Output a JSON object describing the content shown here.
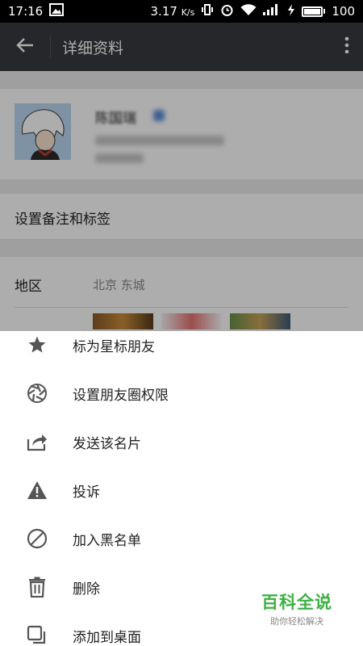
{
  "status_bar": {
    "time": "17:16",
    "speed": "3.17",
    "speed_unit": "K/s",
    "battery": "100",
    "battery_level": 1.0
  },
  "app_bar": {
    "title": "详细资料",
    "back_icon": "back-arrow-icon",
    "more_icon": "more-vertical-icon"
  },
  "profile": {
    "name": "陈国瑞",
    "wechat_id_label": "微信号",
    "nickname_label": "昵称"
  },
  "rows": {
    "remark": "设置备注和标签",
    "region_label": "地区",
    "region_value": "北京  东城"
  },
  "menu": {
    "items": [
      {
        "label": "标为星标朋友",
        "icon": "star-icon"
      },
      {
        "label": "设置朋友圈权限",
        "icon": "aperture-icon"
      },
      {
        "label": "发送该名片",
        "icon": "share-icon"
      },
      {
        "label": "投诉",
        "icon": "warning-icon"
      },
      {
        "label": "加入黑名单",
        "icon": "block-icon"
      },
      {
        "label": "删除",
        "icon": "trash-icon"
      },
      {
        "label": "添加到桌面",
        "icon": "add-to-desktop-icon"
      }
    ]
  },
  "watermark": {
    "title": "百科全说",
    "subtitle": "助你轻松解决"
  },
  "colors": {
    "app_bar": "#393a3f",
    "icon": "#555555",
    "watermark": "#3cb043"
  }
}
